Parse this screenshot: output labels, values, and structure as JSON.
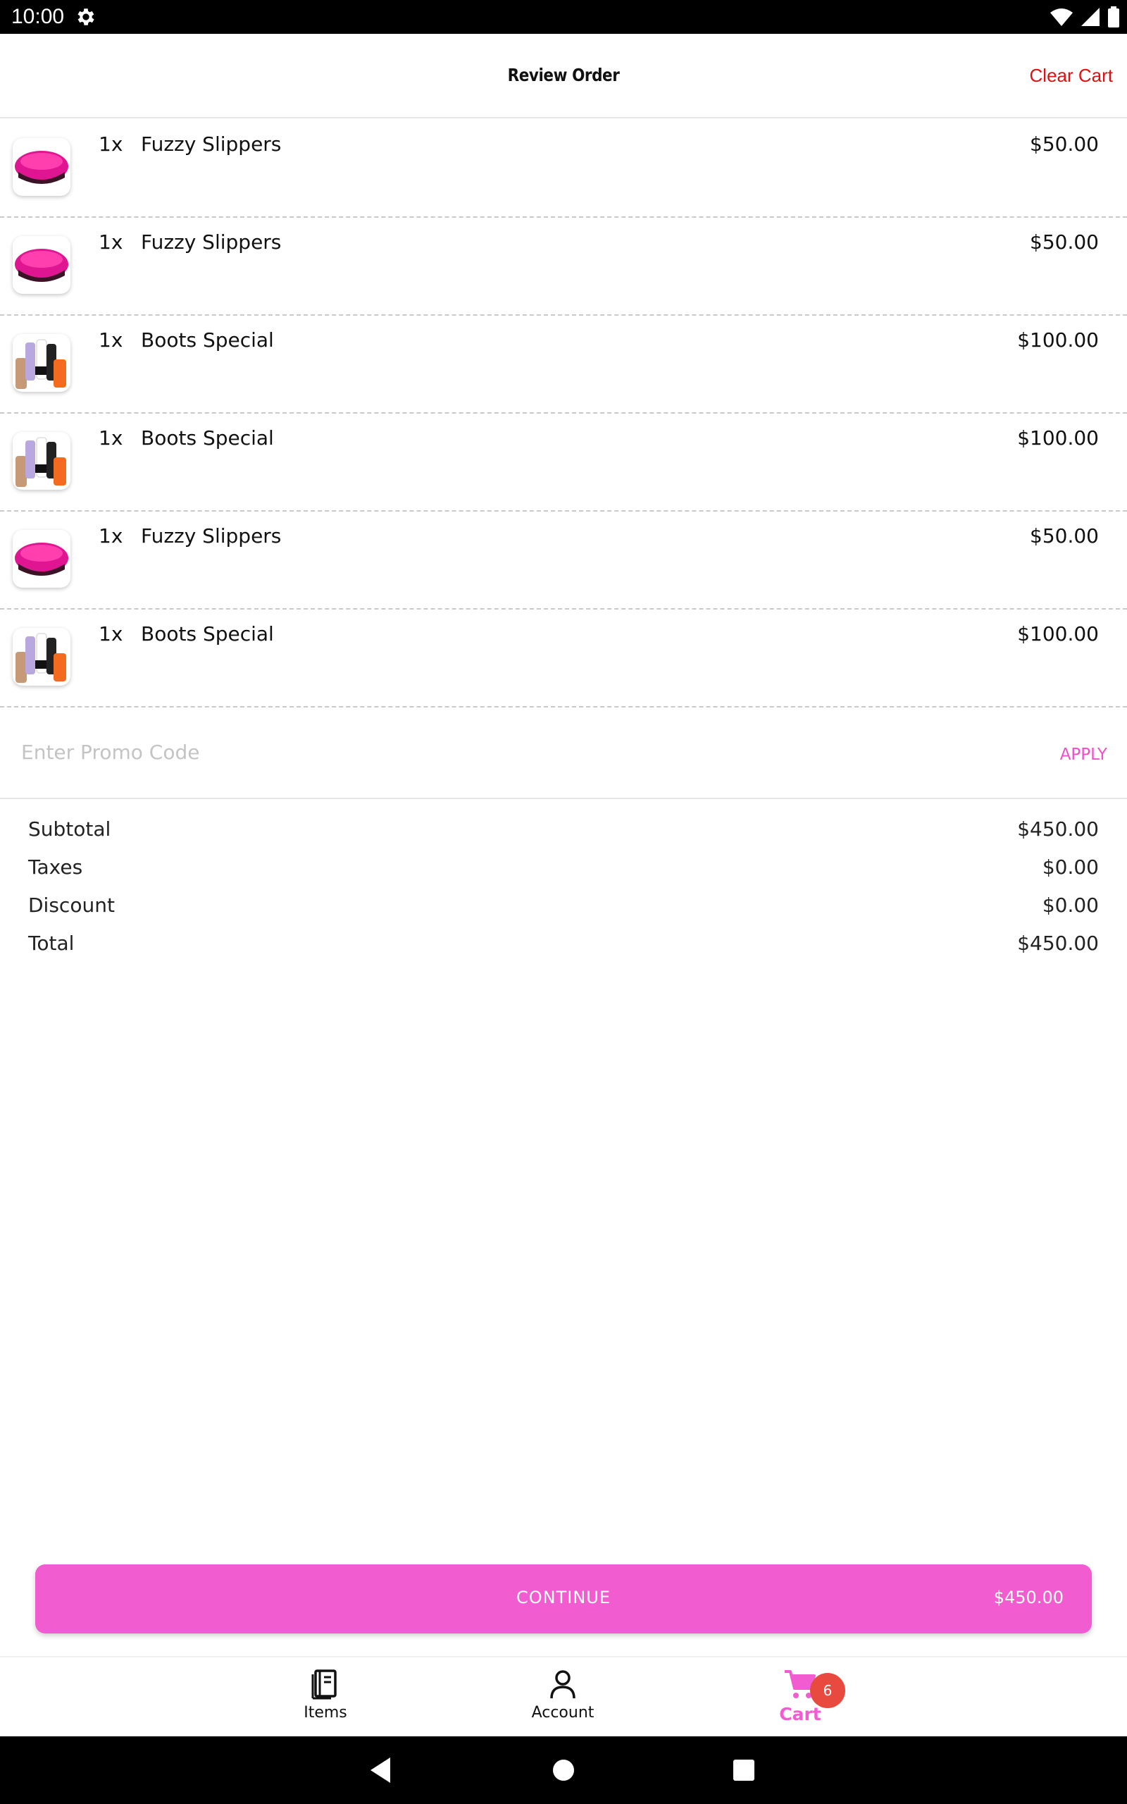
{
  "status_bar": {
    "time": "10:00"
  },
  "header": {
    "title": "Review Order",
    "clear_cart_label": "Clear Cart"
  },
  "cart_items": [
    {
      "qty": "1x",
      "name": "Fuzzy Slippers",
      "price": "$50.00",
      "image": "fuzzy-slippers-thumbnail"
    },
    {
      "qty": "1x",
      "name": "Fuzzy Slippers",
      "price": "$50.00",
      "image": "fuzzy-slippers-thumbnail"
    },
    {
      "qty": "1x",
      "name": "Boots Special",
      "price": "$100.00",
      "image": "boots-thumbnail"
    },
    {
      "qty": "1x",
      "name": "Boots Special",
      "price": "$100.00",
      "image": "boots-thumbnail"
    },
    {
      "qty": "1x",
      "name": "Fuzzy Slippers",
      "price": "$50.00",
      "image": "fuzzy-slippers-thumbnail"
    },
    {
      "qty": "1x",
      "name": "Boots Special",
      "price": "$100.00",
      "image": "boots-thumbnail"
    }
  ],
  "promo": {
    "placeholder": "Enter Promo Code",
    "value": "",
    "apply_label": "APPLY"
  },
  "summary": [
    {
      "label": "Subtotal",
      "value": "$450.00"
    },
    {
      "label": "Taxes",
      "value": "$0.00"
    },
    {
      "label": "Discount",
      "value": "$0.00"
    },
    {
      "label": "Total",
      "value": "$450.00"
    }
  ],
  "continue_button": {
    "label": "CONTINUE",
    "total": "$450.00"
  },
  "bottom_nav": {
    "items": [
      {
        "label": "Items",
        "icon": "book-icon"
      },
      {
        "label": "Account",
        "icon": "person-icon"
      },
      {
        "label": "Cart",
        "icon": "cart-icon",
        "active": true
      }
    ],
    "cart_badge": "6"
  },
  "colors": {
    "accent": "#f15cd1",
    "clear_cart": "#e01010",
    "badge": "#e84a3f"
  }
}
